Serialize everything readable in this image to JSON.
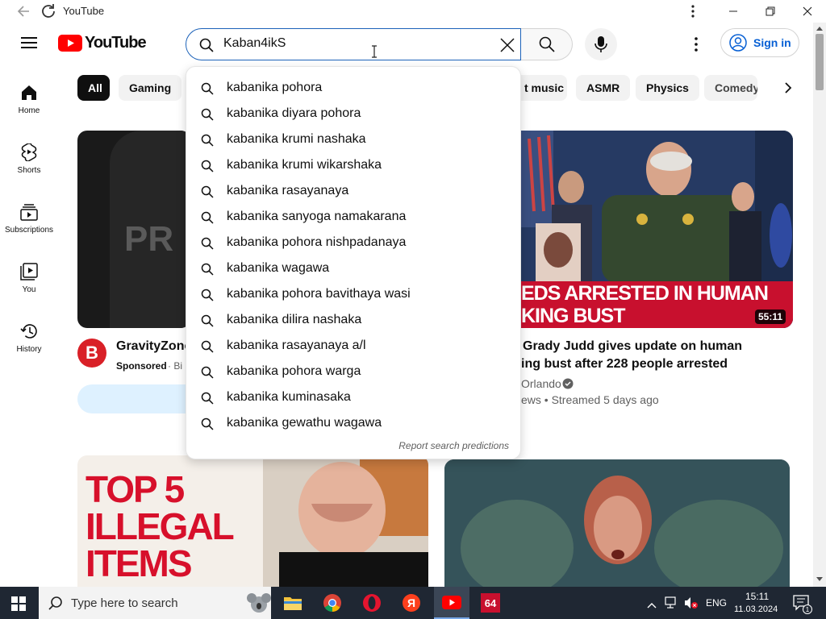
{
  "window": {
    "title": "YouTube"
  },
  "masthead": {
    "logo_text": "YouTube",
    "search_value": "Kaban4ikS",
    "signin_label": "Sign in"
  },
  "sidebar": {
    "items": [
      {
        "label": "Home"
      },
      {
        "label": "Shorts"
      },
      {
        "label": "Subscriptions"
      },
      {
        "label": "You"
      },
      {
        "label": "History"
      }
    ]
  },
  "chips": [
    "All",
    "Gaming",
    "t music",
    "ASMR",
    "Physics",
    "Comedy"
  ],
  "suggestions": [
    "kabanika pohora",
    "kabanika diyara pohora",
    "kabanika krumi nashaka",
    "kabanika krumi wikarshaka",
    "kabanika rasayanaya",
    "kabanika sanyoga namakarana",
    "kabanika pohora nishpadanaya",
    "kabanika wagawa",
    "kabanika pohora bavithaya wasi",
    "kabanika dilira nashaka",
    "kabanika rasayanaya a/l",
    "kabanika pohora warga",
    "kabanika kuminasaka",
    "kabanika gewathu wagawa"
  ],
  "report_label": "Report search predictions",
  "videos": {
    "left": {
      "thumb_text": "PR",
      "channel_initial": "B",
      "title": "GravityZone",
      "sponsored": "Sponsored",
      "meta": "· Bi"
    },
    "right": {
      "headline1": "EDS ARRESTED IN HUMAN",
      "headline2": "KING BUST",
      "duration": "55:11",
      "title_line1": "Grady Judd gives update on human",
      "title_line2": "ing bust after 228 people arrested",
      "channel": "Orlando",
      "meta": "ews • Streamed 5 days ago"
    },
    "bottom_left": {
      "line1": "TOP 5",
      "line2": "ILLEGAL",
      "line3": "ITEMS"
    }
  },
  "taskbar": {
    "search_placeholder": "Type here to search",
    "lang": "ENG",
    "time": "15:11",
    "date": "11.03.2024",
    "app_label": "64",
    "notif_count": "1"
  },
  "colors": {
    "youtube_red": "#ff0000",
    "link_blue": "#065fd4",
    "taskbar": "#1f2733"
  }
}
